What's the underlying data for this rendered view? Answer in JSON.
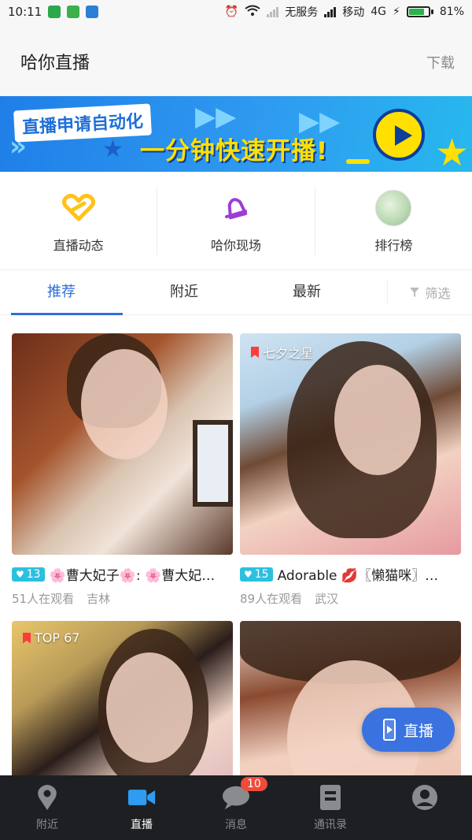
{
  "status_bar": {
    "time": "10:11",
    "no_service": "无服务",
    "carrier": "移动",
    "network": "4G",
    "battery": "81%",
    "battery_level": 0.81
  },
  "header": {
    "title": "哈你直播",
    "download": "下载"
  },
  "banner": {
    "line1": "直播申请自动化",
    "line2": "一分钟快速开播!"
  },
  "quick_nav": [
    {
      "label": "直播动态",
      "icon": "heart-link-icon"
    },
    {
      "label": "哈你现场",
      "icon": "bell-icon"
    },
    {
      "label": "排行榜",
      "icon": "ranking-avatar"
    }
  ],
  "tabs": {
    "items": [
      "推荐",
      "附近",
      "最新"
    ],
    "active": "推荐",
    "filter": "筛选"
  },
  "cards": [
    {
      "level": "13",
      "title": "🌸曹大妃子🌸: 🌸曹大妃…",
      "viewers": "51人在观看",
      "location": "吉林",
      "badge": ""
    },
    {
      "level": "15",
      "title": "Adorable 💋〖懒猫咪〗…",
      "viewers": "89人在观看",
      "location": "武汉",
      "badge": "七夕之星"
    },
    {
      "badge": "TOP 67"
    },
    {
      "badge": ""
    }
  ],
  "live_button": {
    "label": "直播"
  },
  "bottom_nav": {
    "items": [
      "附近",
      "直播",
      "消息",
      "通讯录",
      ""
    ],
    "active": "直播",
    "message_badge": "10"
  },
  "colors": {
    "accent": "#2e6fd8",
    "level_badge": "#2bc0e0",
    "banner_yellow": "#ffe000",
    "nav_bg": "#1e1f22",
    "notif_badge": "#f04a3a"
  }
}
